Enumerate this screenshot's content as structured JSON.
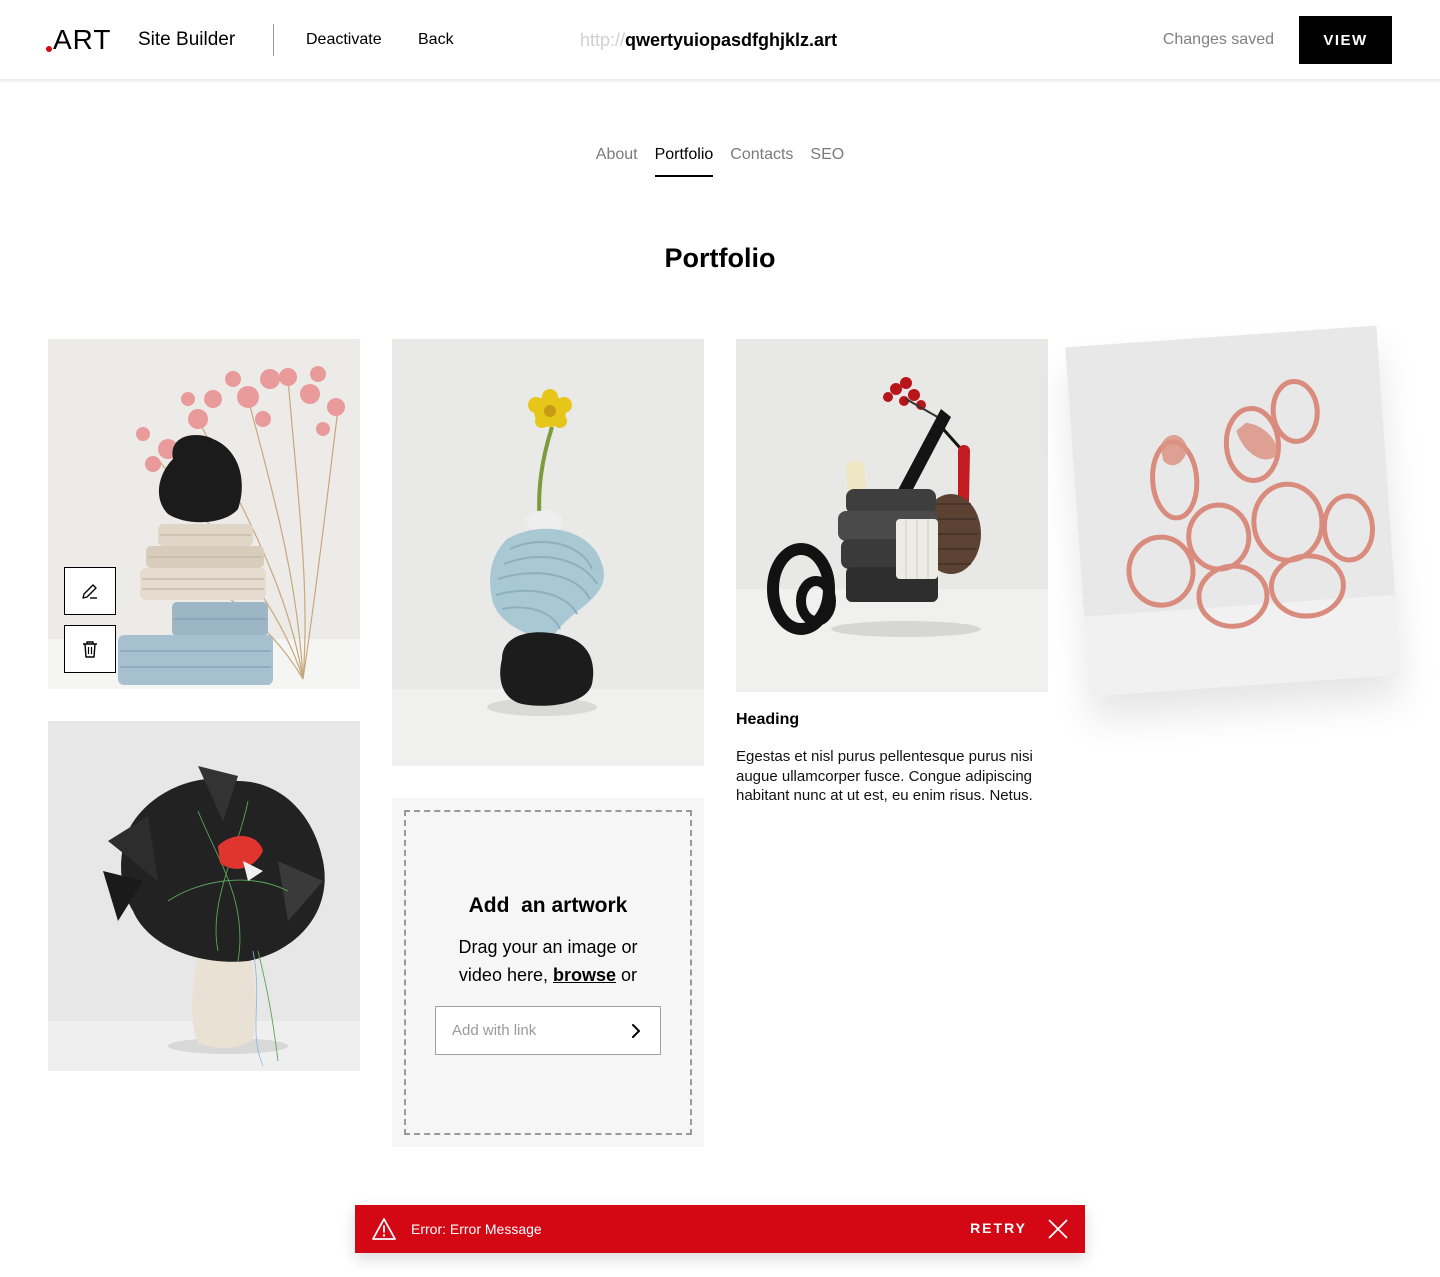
{
  "header": {
    "logo_text": "ART",
    "app_title": "Site Builder",
    "deactivate_label": "Deactivate",
    "back_label": "Back",
    "url_protocol": "http://",
    "url_domain": "qwertyuiopasdfghjklz.art",
    "status_text": "Changes saved",
    "view_label": "VIEW"
  },
  "tabs": [
    {
      "label": "About",
      "active": false
    },
    {
      "label": "Portfolio",
      "active": true
    },
    {
      "label": "Contacts",
      "active": false
    },
    {
      "label": "SEO",
      "active": false
    }
  ],
  "page": {
    "title": "Portfolio"
  },
  "artworks": [
    {
      "icon": "still-life-sculpture-image"
    },
    {
      "icon": "fabric-sculpture-image"
    },
    {
      "icon": "vase-flower-image"
    },
    {
      "icon": "scissors-assemblage-image",
      "heading": "Heading",
      "description": "Egestas et nisl purus pellentesque purus nisi augue ullamcorper fusce. Congue adipiscing habitant nunc at ut est, eu enim risus. Netus."
    },
    {
      "icon": "paper-coils-image",
      "state": "dragging"
    }
  ],
  "card_actions": {
    "edit_icon": "pencil-icon",
    "delete_icon": "trash-icon"
  },
  "add_artwork": {
    "title": "Add  an artwork",
    "instruction_line1": "Drag your an image or",
    "instruction_line2_pre": "video here,",
    "browse_label": "browse",
    "instruction_line2_post": "or",
    "link_placeholder": "Add with link",
    "link_icon": "chevron-right-icon"
  },
  "error": {
    "icon": "warning-icon",
    "message": "Error: Error Message",
    "retry_label": "RETRY",
    "close_icon": "close-icon"
  },
  "colors": {
    "accent_red": "#d40714",
    "primary_black": "#000000",
    "muted_gray": "#808080"
  }
}
